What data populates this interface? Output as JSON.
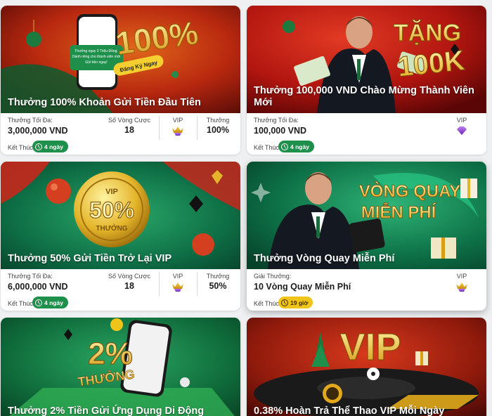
{
  "colors": {
    "green": "#1f8f4c",
    "yellow": "#f0c419"
  },
  "cards": [
    {
      "title": "Thưởng 100% Khoản Gửi Tiền Đầu Tiên",
      "banner_text": "100%",
      "banner_cta": "Đăng Ký Ngay",
      "banner_phone_text": "Thưởng ngay 3 Triệu Đồng. Dành riêng cho thành viên mới Gửi tiền ngay!",
      "max_label": "Thưởng Tối Đa:",
      "max_value": "3,000,000 VND",
      "rounds_label": "Số Vòng Cược",
      "rounds_value": "18",
      "vip_label": "VIP",
      "bonus_label": "Thưởng",
      "bonus_value": "100%",
      "end_label": "Kết Thúc:",
      "end_value": "4 ngày"
    },
    {
      "title": "Thưởng 100,000 VND Chào Mừng Thành Viên Mới",
      "banner_text_1": "TẶNG",
      "banner_text_2": "100K",
      "max_label": "Thưởng Tối Đa:",
      "max_value": "100,000 VND",
      "vip_label": "VIP",
      "end_label": "Kết Thúc:",
      "end_value": "4 ngày"
    },
    {
      "title": "Thưởng 50% Gửi Tiền Trở Lại VIP",
      "banner_text_1": "VIP",
      "banner_text_2": "50%",
      "banner_text_3": "THƯỞNG",
      "max_label": "Thưởng Tối Đa:",
      "max_value": "6,000,000 VND",
      "rounds_label": "Số Vòng Cược",
      "rounds_value": "18",
      "vip_label": "VIP",
      "bonus_label": "Thưởng",
      "bonus_value": "50%",
      "end_label": "Kết Thúc:",
      "end_value": "4 ngày"
    },
    {
      "title": "Thưởng Vòng Quay Miễn Phí",
      "banner_text_1": "VÒNG QUAY",
      "banner_text_2": "MIỄN PHÍ",
      "prize_label": "Giải Thưởng:",
      "prize_value": "10 Vòng Quay Miễn Phí",
      "vip_label": "VIP",
      "end_label": "Kết Thúc:",
      "end_value": "19 giờ"
    },
    {
      "title": "Thưởng 2% Tiền Gửi Ứng Dụng Di Động",
      "banner_text_1": "2%",
      "banner_text_2": "THƯỞNG"
    },
    {
      "title": "0.38% Hoàn Trả Thể Thao VIP Mỗi Ngày",
      "banner_text": "VIP"
    }
  ]
}
